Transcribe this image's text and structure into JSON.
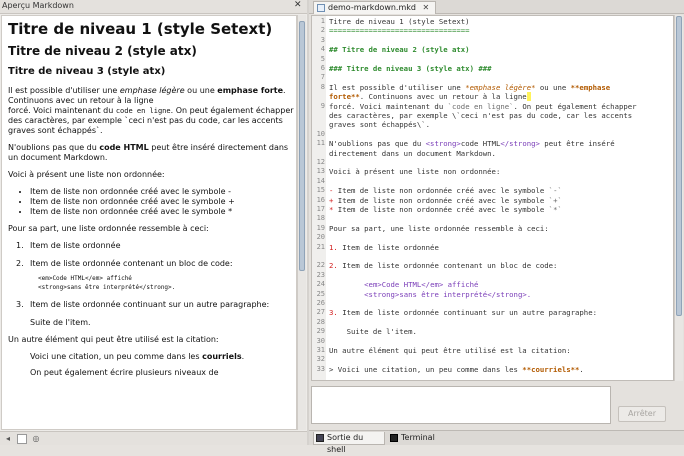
{
  "left_panel": {
    "title": "Aperçu Markdown",
    "close_glyph": "✕"
  },
  "preview": {
    "h1": "Titre de niveau 1 (style Setext)",
    "h2": "Titre de niveau 2 (style atx)",
    "h3": "Titre de niveau 3 (style atx)",
    "p1_a": "Il est possible d'utiliser une ",
    "p1_em": "emphase légère",
    "p1_b": " ou une ",
    "p1_strong": "emphase forte",
    "p1_c": ". Continuons avec un retour à la ligne",
    "p1_d": "forcé. Voici maintenant du ",
    "p1_code": "code en ligne",
    "p1_e": ". On peut également échapper des caractères, par exemple `ceci n'est pas du code, car les accents graves sont échappés`.",
    "p2_a": "N'oublions pas que du ",
    "p2_strong": "code HTML",
    "p2_b": " peut être inséré directement dans un document Markdown.",
    "p3": "Voici à présent une liste non ordonnée:",
    "ul_items": [
      "Item de liste non ordonnée créé avec le symbole -",
      "Item de liste non ordonnée créé avec le symbole +",
      "Item de liste non ordonnée créé avec le symbole *"
    ],
    "p4": "Pour sa part, une liste ordonnée ressemble à ceci:",
    "ol_1": "Item de liste ordonnée",
    "ol_2": "Item de liste ordonnée contenant un bloc de code:",
    "ol_code_1": "<em>Code HTML</em> affiché",
    "ol_code_2": "<strong>sans être interprété</strong>.",
    "ol_3": "Item de liste ordonnée continuant sur un autre paragraphe:",
    "ol_3_cont": "Suite de l'item.",
    "p5": "Un autre élément qui peut être utilisé est la citation:",
    "quote_a": "Voici une citation, un peu comme dans les ",
    "quote_strong": "courriels",
    "quote_b": ".",
    "quote_cut": "On peut également écrire plusieurs niveaux de"
  },
  "editor": {
    "tab_label": "demo-markdown.mkd",
    "tab_close": "✕",
    "lines": [
      {
        "n": "1",
        "t": "Titre de niveau 1 (style Setext)"
      },
      {
        "n": "2",
        "t": "================================"
      },
      {
        "n": "3",
        "t": ""
      },
      {
        "n": "4",
        "t": "## Titre de niveau 2 (style atx)"
      },
      {
        "n": "5",
        "t": ""
      },
      {
        "n": "6",
        "t": "### Titre de niveau 3 (style atx) ###"
      },
      {
        "n": "7",
        "t": ""
      },
      {
        "n": "8",
        "t": "Il est possible d'utiliser une *emphase légère* ou une **emphase"
      },
      {
        "n": "",
        "t": "forte**. Continuons avec un retour à la ligne"
      },
      {
        "n": "9",
        "t": "forcé. Voici maintenant du `code en ligne`. On peut également échapper"
      },
      {
        "n": "",
        "t": "des caractères, par exemple \\`ceci n'est pas du code, car les accents"
      },
      {
        "n": "",
        "t": "graves sont échappés\\`."
      },
      {
        "n": "10",
        "t": ""
      },
      {
        "n": "11",
        "t": "N'oublions pas que du <strong>code HTML</strong> peut être inséré"
      },
      {
        "n": "",
        "t": "directement dans un document Markdown."
      },
      {
        "n": "12",
        "t": ""
      },
      {
        "n": "13",
        "t": "Voici à présent une liste non ordonnée:"
      },
      {
        "n": "14",
        "t": ""
      },
      {
        "n": "15",
        "t": "- Item de liste non ordonnée créé avec le symbole `-`"
      },
      {
        "n": "16",
        "t": "+ Item de liste non ordonnée créé avec le symbole `+`"
      },
      {
        "n": "17",
        "t": "* Item de liste non ordonnée créé avec le symbole `*`"
      },
      {
        "n": "18",
        "t": ""
      },
      {
        "n": "19",
        "t": "Pour sa part, une liste ordonnée ressemble à ceci:"
      },
      {
        "n": "20",
        "t": ""
      },
      {
        "n": "21",
        "t": "1. Item de liste ordonnée"
      },
      {
        "n": "",
        "t": ""
      },
      {
        "n": "22",
        "t": "2. Item de liste ordonnée contenant un bloc de code:"
      },
      {
        "n": "23",
        "t": ""
      },
      {
        "n": "24",
        "t": "        <em>Code HTML</em> affiché"
      },
      {
        "n": "25",
        "t": "        <strong>sans être interprété</strong>."
      },
      {
        "n": "26",
        "t": ""
      },
      {
        "n": "27",
        "t": "3. Item de liste ordonnée continuant sur un autre paragraphe:"
      },
      {
        "n": "28",
        "t": ""
      },
      {
        "n": "29",
        "t": "    Suite de l'item."
      },
      {
        "n": "30",
        "t": ""
      },
      {
        "n": "31",
        "t": "Un autre élément qui peut être utilisé est la citation:"
      },
      {
        "n": "32",
        "t": ""
      },
      {
        "n": "33",
        "t": "> Voici une citation, un peu comme dans les **courriels**."
      }
    ]
  },
  "shell": {
    "stop_label": "Arrêter"
  },
  "bottom_tabs": {
    "shell_label": "Sortie du shell",
    "terminal_label": "Terminal"
  },
  "colors": {
    "heading_green": "#2e8b2e",
    "emphasis_orange": "#b25a00",
    "list_marker_red": "#d21e1e",
    "html_purple": "#7a3db8"
  }
}
